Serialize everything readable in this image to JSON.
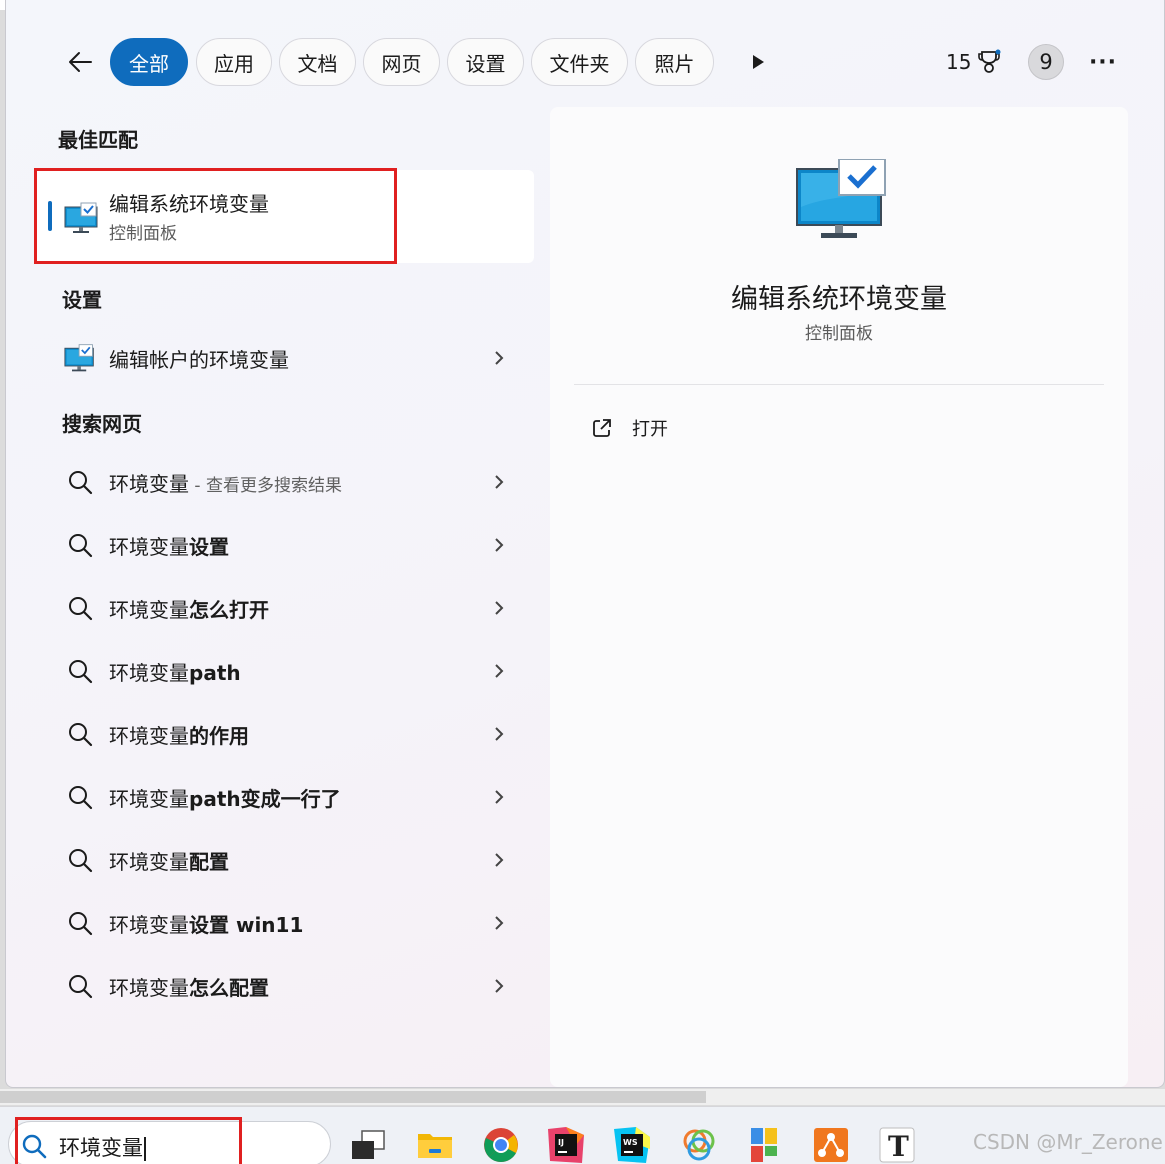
{
  "filters": {
    "back_icon": "back-arrow-icon",
    "chips": [
      "全部",
      "应用",
      "文档",
      "网页",
      "设置",
      "文件夹",
      "照片"
    ],
    "active_chip": "全部",
    "more_filters_icon": "play-icon",
    "points": "15",
    "points_icon": "trophy-icon",
    "avatar": "9",
    "more_label": "···"
  },
  "best_match": {
    "section_title": "最佳匹配",
    "title": "编辑系统环境变量",
    "subtitle": "控制面板",
    "icon": "monitor-check-icon"
  },
  "settings": {
    "section_title": "设置",
    "items": [
      {
        "label": "编辑帐户的环境变量",
        "icon": "monitor-check-icon"
      }
    ]
  },
  "web": {
    "section_title": "搜索网页",
    "items": [
      {
        "query": "环境变量",
        "suffix": "",
        "hint": " - 查看更多搜索结果"
      },
      {
        "query": "环境变量",
        "suffix": "设置",
        "hint": ""
      },
      {
        "query": "环境变量",
        "suffix": "怎么打开",
        "hint": ""
      },
      {
        "query": "环境变量",
        "suffix": "path",
        "hint": ""
      },
      {
        "query": "环境变量",
        "suffix": "的作用",
        "hint": ""
      },
      {
        "query": "环境变量",
        "suffix": "path变成一行了",
        "hint": ""
      },
      {
        "query": "环境变量",
        "suffix": "配置",
        "hint": ""
      },
      {
        "query": "环境变量",
        "suffix": "设置 win11",
        "hint": ""
      },
      {
        "query": "环境变量",
        "suffix": "怎么配置",
        "hint": ""
      }
    ]
  },
  "detail": {
    "title": "编辑系统环境变量",
    "subtitle": "控制面板",
    "open_label": "打开",
    "open_icon": "open-external-icon"
  },
  "taskbar": {
    "search_value": "环境变量",
    "search_icon": "search-icon",
    "apps": [
      "task-view-icon",
      "file-explorer-icon",
      "chrome-icon",
      "intellij-idea-icon",
      "webstorm-icon",
      "app-swirl-icon",
      "app-tiles-icon",
      "app-network-icon",
      "typora-icon"
    ],
    "typora_glyph": "T",
    "ij_glyph": "IJ",
    "ws_glyph": "WS"
  },
  "watermark": "CSDN @Mr_Zerone",
  "colors": {
    "accent": "#0f6cbd",
    "highlight": "#e02020"
  }
}
